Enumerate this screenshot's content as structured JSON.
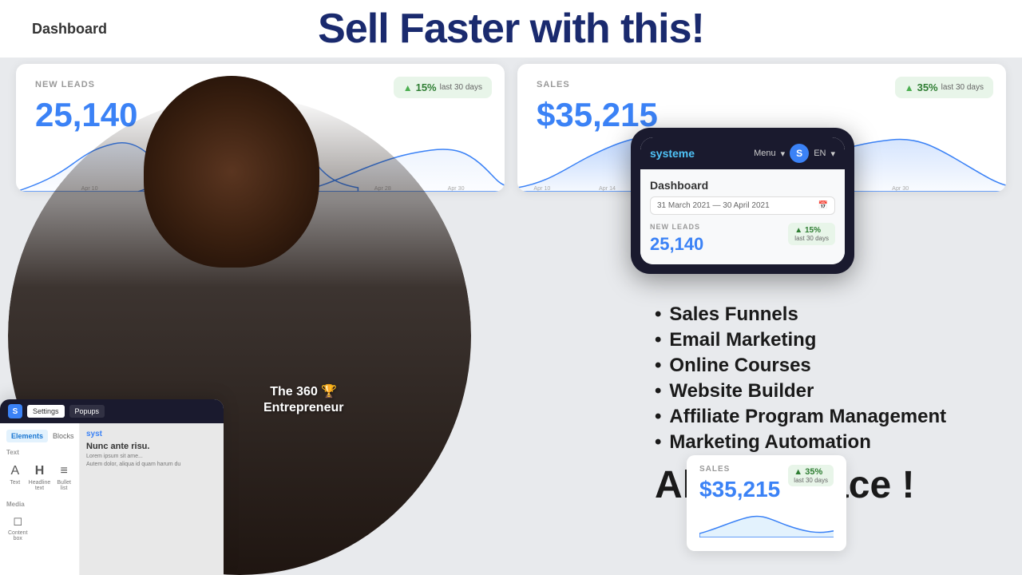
{
  "header": {
    "dashboard_label": "Dashboard",
    "main_headline": "Sell Faster with this!"
  },
  "card_leads": {
    "label": "NEW LEADS",
    "value": "25,140",
    "badge_percent": "15%",
    "badge_sub": "last 30 days"
  },
  "card_sales": {
    "label": "SALES",
    "value": "$35,215",
    "badge_percent": "35%",
    "badge_sub": "last 30 days"
  },
  "mobile": {
    "brand": "systeme",
    "menu_label": "Menu",
    "lang": "EN",
    "avatar_letter": "S",
    "dashboard_title": "Dashboard",
    "date_range": "31 March 2021 — 30 April 2021",
    "metric_label": "NEW LEADS",
    "metric_value": "25,140",
    "badge_percent": "▲ 15%",
    "badge_sub": "last 30 days"
  },
  "features": {
    "items": [
      "Sales Funnels",
      "Email Marketing",
      "Online Courses",
      "Website Builder",
      "Affiliate Program Management",
      "Marketing Automation"
    ],
    "cta": "All in 1 Place !"
  },
  "builder": {
    "tabs": [
      "Settings",
      "Popups"
    ],
    "sidebar_tabs": [
      "Elements",
      "Blocks"
    ],
    "text_section": "Text",
    "media_section": "Media",
    "elements": [
      {
        "label": "Text",
        "icon": "A"
      },
      {
        "label": "Headline text",
        "icon": "H"
      },
      {
        "label": "Bullet list",
        "icon": "≡"
      },
      {
        "label": "Content box",
        "icon": "☐"
      }
    ],
    "canvas_brand": "syst",
    "canvas_heading": "Nunc ante risu.",
    "canvas_body": "Lorem ipsum sit ame...",
    "canvas_body2": "Autem dolor, aliqua id quam harum du"
  },
  "mini_sales": {
    "label": "SALES",
    "value": "$35,215",
    "badge": "▲ 35%",
    "badge_sub": "last 30 days"
  },
  "date_labels": {
    "march": "March 2021",
    "april": "April 2021"
  },
  "colors": {
    "primary_blue": "#3b82f6",
    "dark_navy": "#1a2a6e",
    "green_badge": "#e8f5e9",
    "green_text": "#2e7d32"
  }
}
